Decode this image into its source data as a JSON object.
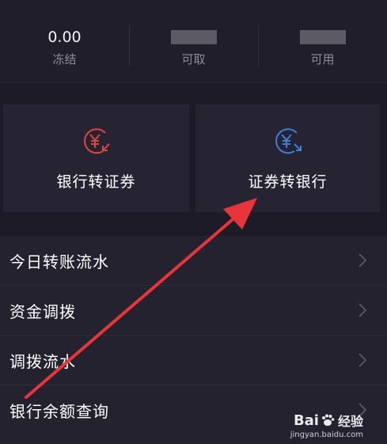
{
  "summary": [
    {
      "value": "0.00",
      "label": "冻结"
    },
    {
      "value": "",
      "label": "可取",
      "masked": true
    },
    {
      "value": "",
      "label": "可用",
      "masked": true
    }
  ],
  "transfers": {
    "bank_to_securities": {
      "label": "银行转证券",
      "icon": "yen-in-icon",
      "color": "#d9473f"
    },
    "securities_to_bank": {
      "label": "证券转银行",
      "icon": "yen-out-icon",
      "color": "#3d7fd9"
    }
  },
  "menu": [
    {
      "label": "今日转账流水"
    },
    {
      "label": "资金调拨"
    },
    {
      "label": "调拨流水"
    },
    {
      "label": "银行余额查询"
    }
  ],
  "annotation": {
    "color": "#e8353a"
  },
  "watermark": {
    "brand": "Bai",
    "brand2": "经验",
    "url": "jingyan.baidu.com"
  }
}
